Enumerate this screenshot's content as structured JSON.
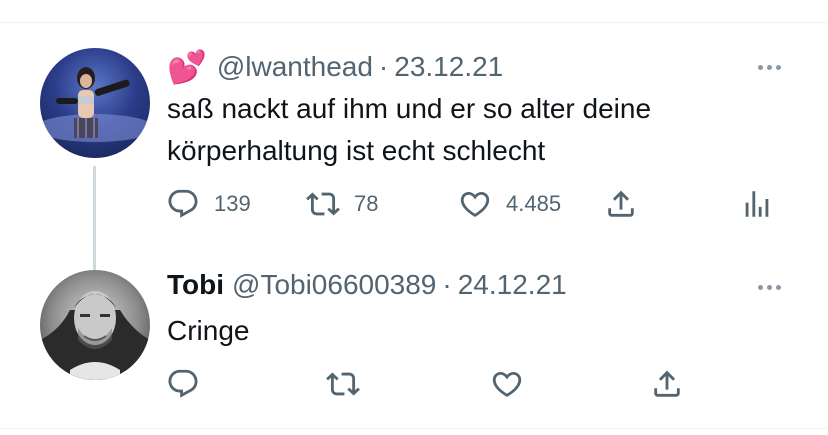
{
  "tweets": [
    {
      "display_name": "💕",
      "handle": "@lwanthead",
      "separator": "·",
      "date": "23.12.21",
      "text_line1": "saß nackt auf ihm und er so alter deine",
      "text_line2": "körperhaltung ist echt schlecht",
      "actions": {
        "reply_icon": "reply-icon",
        "reply_count": "139",
        "retweet_icon": "retweet-icon",
        "retweet_count": "78",
        "like_icon": "heart-icon",
        "like_count": "4.485",
        "share_icon": "share-icon",
        "stats_icon": "analytics-icon"
      }
    },
    {
      "display_name": "Tobi",
      "handle": "@Tobi06600389",
      "separator": "·",
      "date": "24.12.21",
      "text": "Cringe",
      "actions": {
        "reply_icon": "reply-icon",
        "retweet_icon": "retweet-icon",
        "like_icon": "heart-icon",
        "share_icon": "share-icon"
      }
    }
  ],
  "colors": {
    "text": "#0f1419",
    "secondary": "#536471",
    "thread_line": "#cfd9de",
    "emoji_pink": "#ff4fa3"
  }
}
